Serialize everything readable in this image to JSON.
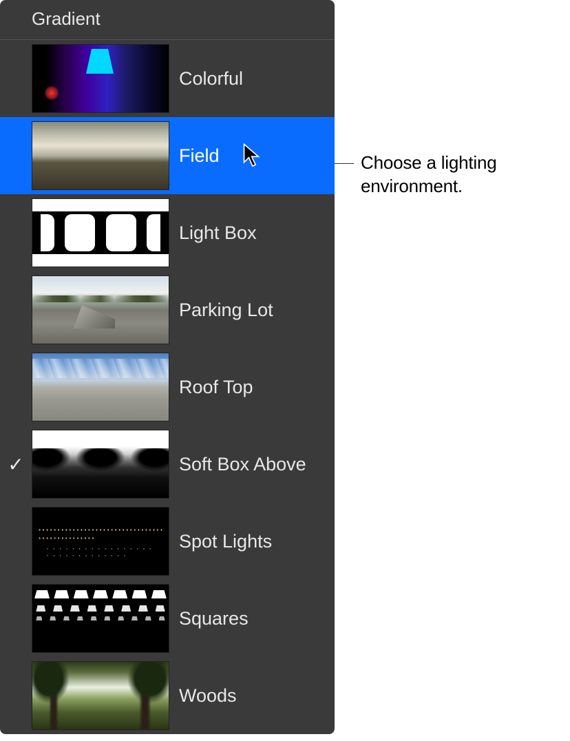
{
  "header": {
    "title": "Gradient"
  },
  "items": [
    {
      "label": "Colorful",
      "checked": false,
      "highlighted": false,
      "thumbClass": "thumb-colorful"
    },
    {
      "label": "Field",
      "checked": false,
      "highlighted": true,
      "thumbClass": "thumb-field"
    },
    {
      "label": "Light Box",
      "checked": false,
      "highlighted": false,
      "thumbClass": "thumb-lightbox"
    },
    {
      "label": "Parking Lot",
      "checked": false,
      "highlighted": false,
      "thumbClass": "thumb-parkinglot"
    },
    {
      "label": "Roof Top",
      "checked": false,
      "highlighted": false,
      "thumbClass": "thumb-rooftop"
    },
    {
      "label": "Soft Box Above",
      "checked": true,
      "highlighted": false,
      "thumbClass": "thumb-softbox"
    },
    {
      "label": "Spot Lights",
      "checked": false,
      "highlighted": false,
      "thumbClass": "thumb-spotlights"
    },
    {
      "label": "Squares",
      "checked": false,
      "highlighted": false,
      "thumbClass": "thumb-squares"
    },
    {
      "label": "Woods",
      "checked": false,
      "highlighted": false,
      "thumbClass": "thumb-woods"
    }
  ],
  "annotation": {
    "text": "Choose a lighting environment."
  },
  "checkmark_glyph": "✓"
}
